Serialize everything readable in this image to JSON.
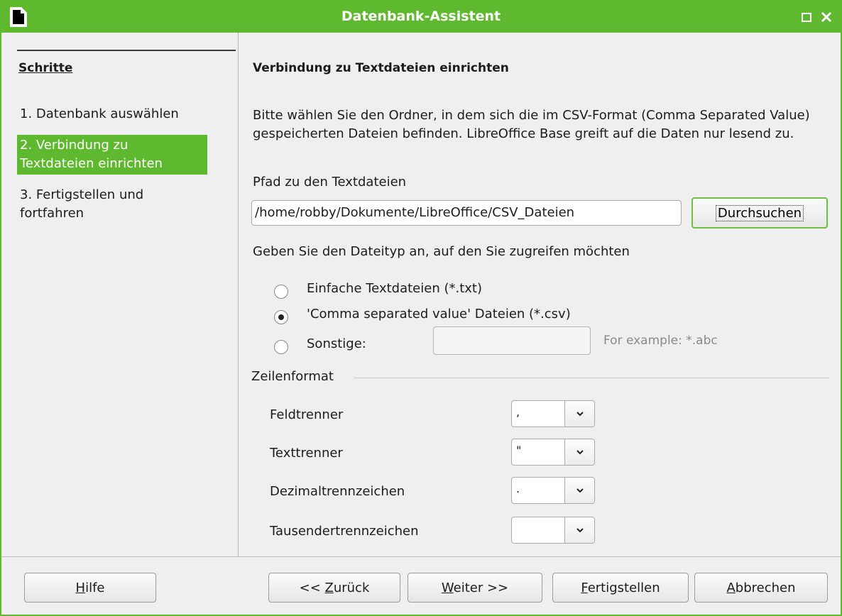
{
  "window": {
    "title": "Datenbank-Assistent",
    "accent": "#5fb92e"
  },
  "sidebar": {
    "header": "Schritte",
    "steps": [
      {
        "label": "1. Datenbank auswählen",
        "active": false
      },
      {
        "label": "2. Verbindung zu Textdateien einrichten",
        "active": true
      },
      {
        "label": "3. Fertigstellen und fortfahren",
        "active": false
      }
    ]
  },
  "main": {
    "heading": "Verbindung zu Textdateien einrichten",
    "description": "Bitte wählen Sie den Ordner, in dem sich die im CSV-Format (Comma Separated Value) gespeicherten Dateien befinden. LibreOffice Base greift auf die Daten nur lesend zu.",
    "path_label": "Pfad zu den Textdateien",
    "path_value": "/home/robby/Dokumente/LibreOffice/CSV_Dateien",
    "browse_label": "Durchsuchen",
    "filetype_label": "Geben Sie den Dateityp an, auf den Sie zugreifen möchten",
    "filetypes": [
      {
        "label": "Einfache Textdateien (*.txt)",
        "selected": false
      },
      {
        "label": "'Comma separated value' Dateien (*.csv)",
        "selected": true
      },
      {
        "label": "Sonstige:",
        "selected": false
      }
    ],
    "other_value": "",
    "other_example": "For example: *.abc",
    "row_format": {
      "label": "Zeilenformat",
      "rows": [
        {
          "label": "Feldtrenner",
          "value": ","
        },
        {
          "label": "Texttrenner",
          "value": "\""
        },
        {
          "label": "Dezimaltrennzeichen",
          "value": "."
        },
        {
          "label": "Tausendertrennzeichen",
          "value": ""
        }
      ]
    }
  },
  "footer": {
    "help": {
      "mnemonic": "H",
      "rest": "ilfe"
    },
    "back": {
      "prefix": "<< ",
      "mnemonic": "Z",
      "rest": "urück"
    },
    "next": {
      "mnemonic": "W",
      "rest": "eiter >>"
    },
    "finish": {
      "mnemonic": "F",
      "rest": "ertigstellen"
    },
    "cancel": {
      "mnemonic": "A",
      "rest": "bbrechen"
    }
  },
  "icons": {
    "app": "libreoffice-document-icon",
    "maximize": "maximize-icon",
    "close": "close-icon",
    "dropdown": "chevron-down-icon"
  }
}
